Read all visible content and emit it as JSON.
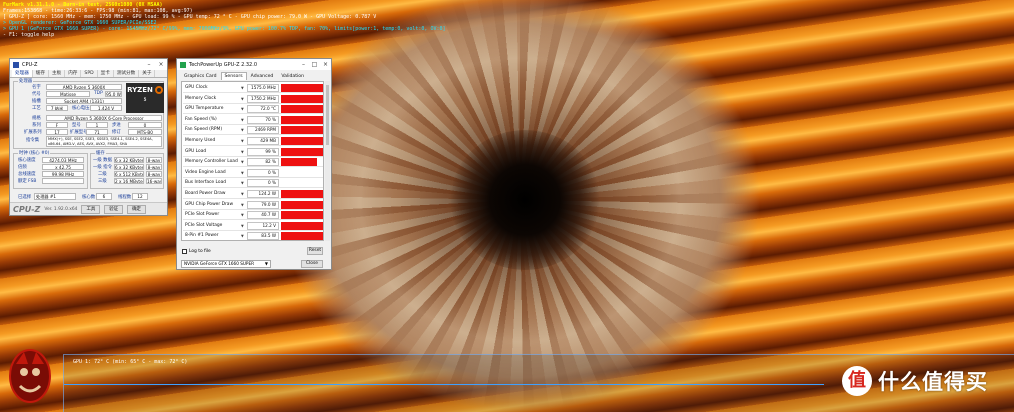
{
  "osd": {
    "title": "FurMark v1.31.1.0 - Burn-in test, 2560x1080 (0X MSAA)",
    "line2": "Frames:153868 - time:26:33:6 - FPS:98 (min:81, max:108, avg:97)",
    "line3": "[ GPU-Z ] core: 1560 MHz - mem: 1750 MHz - GPU load: 99 % - GPU temp: 72 ° C - GPU chip power: 79.0 W - GPU Voltage: 0.787 V",
    "line4": "> OpenGL renderer: GeForce GTX 1660 SUPER/PCIe/SSE2",
    "line5": "> GPU 1 (GeForce GTX 1660 SUPER) - core: 1545MHz/72° C/99%, mem: 7000MHz/9%, GPU power: 100.7% TDP, fan: 70%, limits[power:1, temp:0, volt:0, OV:0]",
    "line6": "- F1: toggle help"
  },
  "cpuz": {
    "title": "CPU-Z",
    "tabs": [
      "处理器",
      "缓存",
      "主板",
      "内存",
      "SPD",
      "显卡",
      "测试分数",
      "关于"
    ],
    "group_processor": "处理器",
    "labels": {
      "name": "名字",
      "codename": "代号",
      "package": "插槽",
      "technology": "工艺",
      "core_voltage": "核心电压",
      "specification": "规格",
      "family": "系列",
      "model": "型号",
      "stepping": "步进",
      "ext_family": "扩展系列",
      "ext_model": "扩展型号",
      "revision": "修订",
      "instructions": "指令集",
      "max_tdp": "TDP"
    },
    "values": {
      "name": "AMD Ryzen 5 3600X",
      "codename": "Matisse",
      "max_tdp": "95.0 W",
      "package": "Socket AM4 (1331)",
      "technology": "7 纳米",
      "core_voltage": "1.424 V",
      "specification": "AMD Ryzen 5 3600X 6-Core Processor",
      "family": "F",
      "model": "1",
      "stepping": "0",
      "ext_family": "17",
      "ext_model": "71",
      "revision": "MTS-B0",
      "instructions": "MMX(+), SSE, SSE2, SSE3, SSSE3, SSE4.1, SSE4.2, SSE4A, x86-64, AMD-V, AES, AVX, AVX2, FMA3, SHA"
    },
    "logo": {
      "brand": "RYZEN",
      "sub": "5"
    },
    "clocks_title": "时钟 (核心 #0)",
    "cache_title": "缓存",
    "clock_labels": {
      "core_speed": "核心速度",
      "multiplier": "倍频",
      "bus_speed": "总线速度",
      "rated_fsb": "额定 FSB"
    },
    "clock_values": {
      "core_speed": "4274.03 MHz",
      "multiplier": "x 42.75",
      "bus_speed": "99.98 MHz",
      "rated_fsb": ""
    },
    "cache_rows": [
      {
        "label": "一级 数据",
        "size": "6 x 32 KBytes",
        "way": "8-way"
      },
      {
        "label": "一级 指令",
        "size": "6 x 32 KBytes",
        "way": "8-way"
      },
      {
        "label": "二级",
        "size": "6 x 512 KBytes",
        "way": "8-way"
      },
      {
        "label": "三级",
        "size": "2 x 16 MBytes",
        "way": "16-way"
      }
    ],
    "selection_label": "已选择",
    "selection_value": "处理器 #1",
    "cores_label": "核心数",
    "cores_value": "6",
    "threads_label": "线程数",
    "threads_value": "12",
    "footer": {
      "brand": "CPU-Z",
      "version": "Ver. 1.92.0.x64",
      "tools": "工具",
      "validate": "验证",
      "ok": "确定"
    }
  },
  "gpuz": {
    "title": "TechPowerUp GPU-Z 2.32.0",
    "tabs": [
      "Graphics Card",
      "Sensors",
      "Advanced",
      "Validation"
    ],
    "active_tab": "Sensors",
    "sensors": [
      {
        "name": "GPU Clock",
        "value": "1575.0 MHz",
        "level": 1.0
      },
      {
        "name": "Memory Clock",
        "value": "1750.2 MHz",
        "level": 1.0
      },
      {
        "name": "GPU Temperature",
        "value": "72.0 °C",
        "level": 1.0
      },
      {
        "name": "Fan Speed (%)",
        "value": "70 %",
        "level": 1.0
      },
      {
        "name": "Fan Speed (RPM)",
        "value": "2469 RPM",
        "level": 1.0
      },
      {
        "name": "Memory Used",
        "value": "429 MB",
        "level": 1.0
      },
      {
        "name": "GPU Load",
        "value": "99 %",
        "level": 1.0
      },
      {
        "name": "Memory Controller Load",
        "value": "82 %",
        "level": 0.85
      },
      {
        "name": "Video Engine Load",
        "value": "0 %",
        "level": 0.0
      },
      {
        "name": "Bus Interface Load",
        "value": "0 %",
        "level": 0.0
      },
      {
        "name": "Board Power Draw",
        "value": "124.2 W",
        "level": 1.0
      },
      {
        "name": "GPU Chip Power Draw",
        "value": "79.0 W",
        "level": 1.0
      },
      {
        "name": "PCIe Slot Power",
        "value": "40.7 W",
        "level": 1.0
      },
      {
        "name": "PCIe Slot Voltage",
        "value": "12.2 V",
        "level": 1.0
      },
      {
        "name": "8-Pin #1 Power",
        "value": "83.5 W",
        "level": 1.0
      }
    ],
    "log_label": "Log to file",
    "reset_label": "Reset",
    "gpu_select": "NVIDIA GeForce GTX 1660 SUPER",
    "close_label": "Close"
  },
  "overlay": {
    "graph_label": "GPU 1: 72° C (min: 65° C - max: 72° C)",
    "watermark_badge": "值",
    "watermark_text": "什么值得买"
  },
  "colors": {
    "sensor_bar": "#ee1111",
    "cpuz_label": "#1a3e9a",
    "osd_title": "#ffff00",
    "osd_info": "#20e0ff"
  }
}
